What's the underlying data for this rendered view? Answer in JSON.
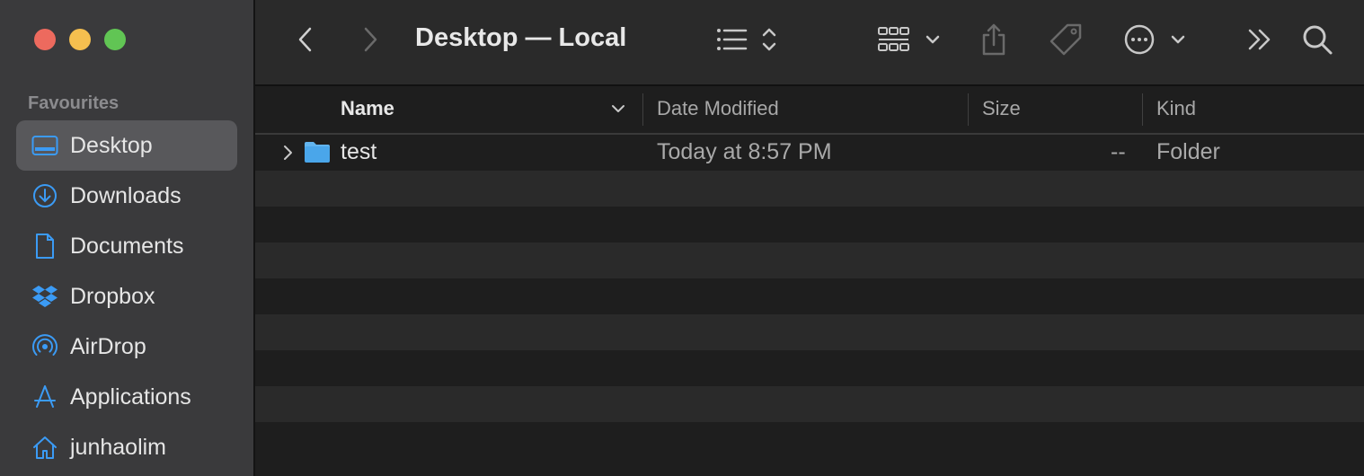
{
  "window": {
    "traffic_lights": {
      "close": "#ed6a5e",
      "minimize": "#f5bf4f",
      "zoom": "#61c554"
    }
  },
  "sidebar": {
    "section_label": "Favourites",
    "items": [
      {
        "label": "Desktop",
        "icon": "desktop-icon",
        "selected": true
      },
      {
        "label": "Downloads",
        "icon": "download-icon"
      },
      {
        "label": "Documents",
        "icon": "document-icon"
      },
      {
        "label": "Dropbox",
        "icon": "dropbox-icon"
      },
      {
        "label": "AirDrop",
        "icon": "airdrop-icon"
      },
      {
        "label": "Applications",
        "icon": "applications-icon"
      },
      {
        "label": "junhaolim",
        "icon": "home-icon"
      }
    ],
    "accent": "#3b9bf5"
  },
  "toolbar": {
    "title": "Desktop — Local",
    "icons": [
      "back-icon",
      "forward-icon",
      "list-view-icon",
      "group-icon",
      "share-icon",
      "tag-icon",
      "more-icon",
      "overflow-icon",
      "search-icon"
    ]
  },
  "table": {
    "columns": {
      "name": "Name",
      "date": "Date Modified",
      "size": "Size",
      "kind": "Kind"
    },
    "rows": [
      {
        "name": "test",
        "date": "Today at 8:57 PM",
        "size": "--",
        "kind": "Folder",
        "icon": "folder-icon"
      }
    ]
  }
}
